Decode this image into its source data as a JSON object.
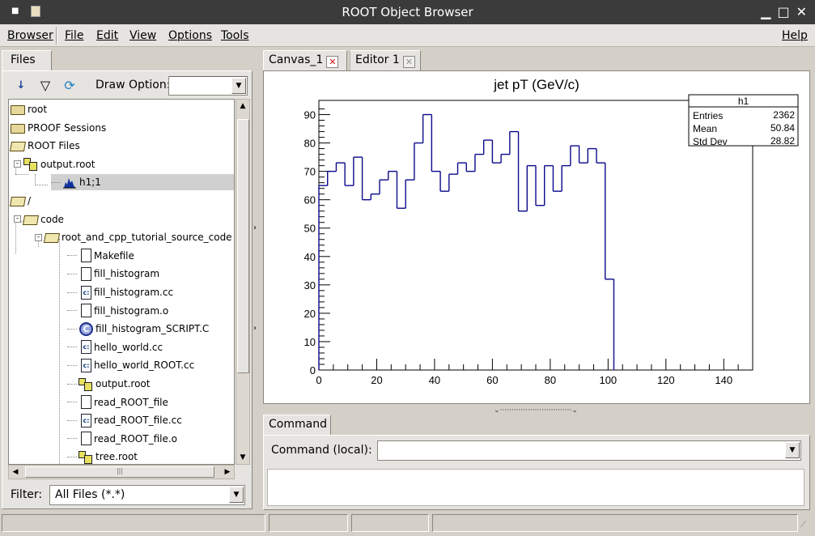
{
  "window": {
    "title": "ROOT Object Browser"
  },
  "menu": {
    "items": [
      "Browser",
      "File",
      "Edit",
      "View",
      "Options",
      "Tools"
    ],
    "help": "Help"
  },
  "left": {
    "tab": "Files",
    "draw_option_label": "Draw Option:",
    "draw_option_value": "",
    "filter_label": "Filter:",
    "filter_value": "All Files (*.*)",
    "tree": [
      {
        "label": "root",
        "icon": "folder-icon",
        "expander": null
      },
      {
        "label": "PROOF Sessions",
        "icon": "folder-icon",
        "expander": null
      },
      {
        "label": "ROOT Files",
        "icon": "open-folder-icon",
        "expander": null
      },
      {
        "label": "output.root",
        "icon": "root-file-icon",
        "expander": "-"
      },
      {
        "label": "h1;1",
        "icon": "histogram-icon",
        "expander": null,
        "selected": true
      },
      {
        "label": "/",
        "icon": "open-folder-icon",
        "expander": null
      },
      {
        "label": "code",
        "icon": "open-folder-icon",
        "expander": "-"
      },
      {
        "label": "root_and_cpp_tutorial_source_code",
        "icon": "open-folder-icon",
        "expander": "-"
      },
      {
        "label": "Makefile",
        "icon": "file-icon",
        "expander": null
      },
      {
        "label": "fill_histogram",
        "icon": "file-icon",
        "expander": null
      },
      {
        "label": "fill_histogram.cc",
        "icon": "c-source-icon",
        "expander": null
      },
      {
        "label": "fill_histogram.o",
        "icon": "file-icon",
        "expander": null
      },
      {
        "label": "fill_histogram_SCRIPT.C",
        "icon": "cpp-macro-icon",
        "expander": null
      },
      {
        "label": "hello_world.cc",
        "icon": "c-source-icon",
        "expander": null
      },
      {
        "label": "hello_world_ROOT.cc",
        "icon": "c-source-icon",
        "expander": null
      },
      {
        "label": "output.root",
        "icon": "root-file-icon",
        "expander": null
      },
      {
        "label": "read_ROOT_file",
        "icon": "file-icon",
        "expander": null
      },
      {
        "label": "read_ROOT_file.cc",
        "icon": "c-source-icon",
        "expander": null
      },
      {
        "label": "read_ROOT_file.o",
        "icon": "file-icon",
        "expander": null
      },
      {
        "label": "tree.root",
        "icon": "root-file-icon",
        "expander": null
      }
    ]
  },
  "right": {
    "tabs": [
      {
        "label": "Canvas_1",
        "close": "✕"
      },
      {
        "label": "Editor 1",
        "close": "✕"
      }
    ],
    "command_tab": "Command",
    "command_label": "Command (local):",
    "command_value": ""
  },
  "stats": {
    "name": "h1",
    "rows": [
      {
        "label": "Entries",
        "value": "2362"
      },
      {
        "label": "Mean",
        "value": "50.84"
      },
      {
        "label": "Std Dev",
        "value": "28.82"
      }
    ]
  },
  "chart_data": {
    "type": "histogram",
    "title": "jet pT (GeV/c)",
    "xlabel": "",
    "ylabel": "",
    "xlim": [
      0,
      150
    ],
    "ylim": [
      0,
      95
    ],
    "x_ticks": [
      0,
      20,
      40,
      60,
      80,
      100,
      120,
      140
    ],
    "y_ticks": [
      0,
      10,
      20,
      30,
      40,
      50,
      60,
      70,
      80,
      90
    ],
    "bin_width": 3,
    "bin_edges_start": 0,
    "values": [
      65,
      70,
      73,
      65,
      75,
      60,
      62,
      67,
      70,
      57,
      67,
      80,
      90,
      70,
      63,
      69,
      73,
      70,
      76,
      81,
      73,
      76,
      84,
      56,
      72,
      58,
      72,
      63,
      72,
      79,
      73,
      78,
      73,
      32,
      0,
      0,
      0,
      0,
      0,
      0,
      0,
      0,
      0,
      0,
      0,
      0,
      0,
      0,
      0,
      0
    ],
    "color": "#0a0a8c",
    "grid": false,
    "legend": "top-right"
  }
}
